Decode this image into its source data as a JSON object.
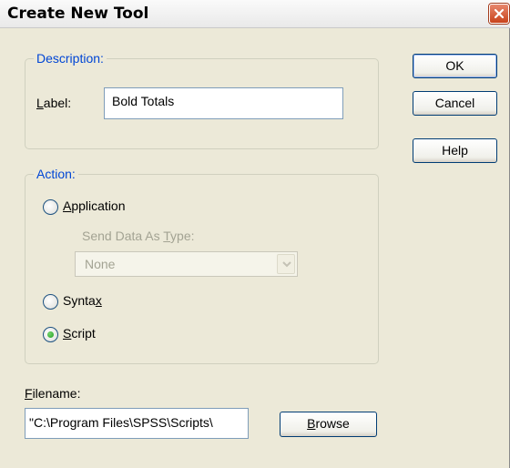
{
  "window": {
    "title": "Create New Tool"
  },
  "buttons": {
    "ok": "OK",
    "cancel": "Cancel",
    "help": "Help",
    "browse_prefix": "",
    "browse_accel": "B",
    "browse_rest": "rowse"
  },
  "description": {
    "legend": "Description:",
    "label_accel": "L",
    "label_rest": "abel:",
    "label_value": "Bold Totals"
  },
  "action": {
    "legend": "Action:",
    "application": {
      "accel": "A",
      "rest": "pplication",
      "selected": false
    },
    "send_data_prefix": "Send Data As ",
    "send_data_accel": "T",
    "send_data_rest": "ype:",
    "send_data_value": "None",
    "syntax": {
      "prefix": "Synta",
      "accel": "x",
      "selected": false
    },
    "script": {
      "accel": "S",
      "rest": "cript",
      "selected": true
    }
  },
  "filename": {
    "label_accel": "F",
    "label_rest": "ilename:",
    "value": "\"C:\\Program Files\\SPSS\\Scripts\\"
  },
  "icons": {
    "close": "close-icon",
    "dropdown": "chevron-down-icon"
  },
  "colors": {
    "legend_text": "#0046d5",
    "disabled_text": "#a3a393",
    "dialog_bg": "#ece9d8",
    "close_button": "#c9431c"
  }
}
